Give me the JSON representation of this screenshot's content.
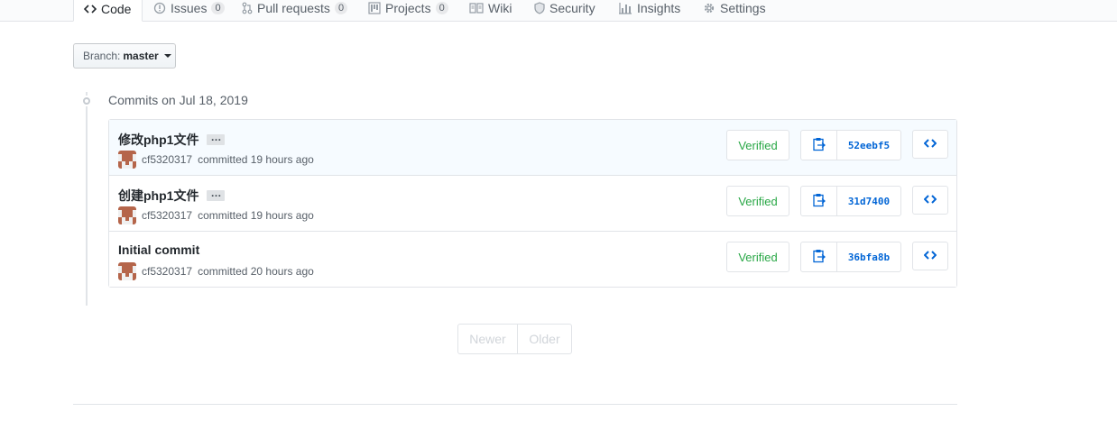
{
  "tabs": [
    {
      "label": "Code",
      "icon": "code-icon",
      "selected": true
    },
    {
      "label": "Issues",
      "icon": "issue-icon",
      "count": "0"
    },
    {
      "label": "Pull requests",
      "icon": "pull-request-icon",
      "count": "0"
    },
    {
      "label": "Projects",
      "icon": "project-icon",
      "count": "0"
    },
    {
      "label": "Wiki",
      "icon": "book-icon"
    },
    {
      "label": "Security",
      "icon": "shield-icon"
    },
    {
      "label": "Insights",
      "icon": "graph-icon"
    },
    {
      "label": "Settings",
      "icon": "gear-icon"
    }
  ],
  "branch": {
    "label": "Branch:",
    "name": "master"
  },
  "commit_group": {
    "title": "Commits on Jul 18, 2019"
  },
  "commits": [
    {
      "message": "修改php1文件",
      "has_ellipsis": true,
      "ellipsis": "…",
      "author": "cf5320317",
      "time": "committed 19 hours ago",
      "verified": "Verified",
      "sha": "52eebf5"
    },
    {
      "message": "创建php1文件",
      "has_ellipsis": true,
      "ellipsis": "…",
      "author": "cf5320317",
      "time": "committed 19 hours ago",
      "verified": "Verified",
      "sha": "31d7400"
    },
    {
      "message": "Initial commit",
      "has_ellipsis": false,
      "author": "cf5320317",
      "time": "committed 20 hours ago",
      "verified": "Verified",
      "sha": "36bfa8b"
    }
  ],
  "pagination": {
    "newer": "Newer",
    "older": "Older"
  },
  "colors": {
    "accent": "#0366d6",
    "verified": "#28a745",
    "tab_selected_border": "#e36209",
    "avatar": "#b5654a"
  }
}
